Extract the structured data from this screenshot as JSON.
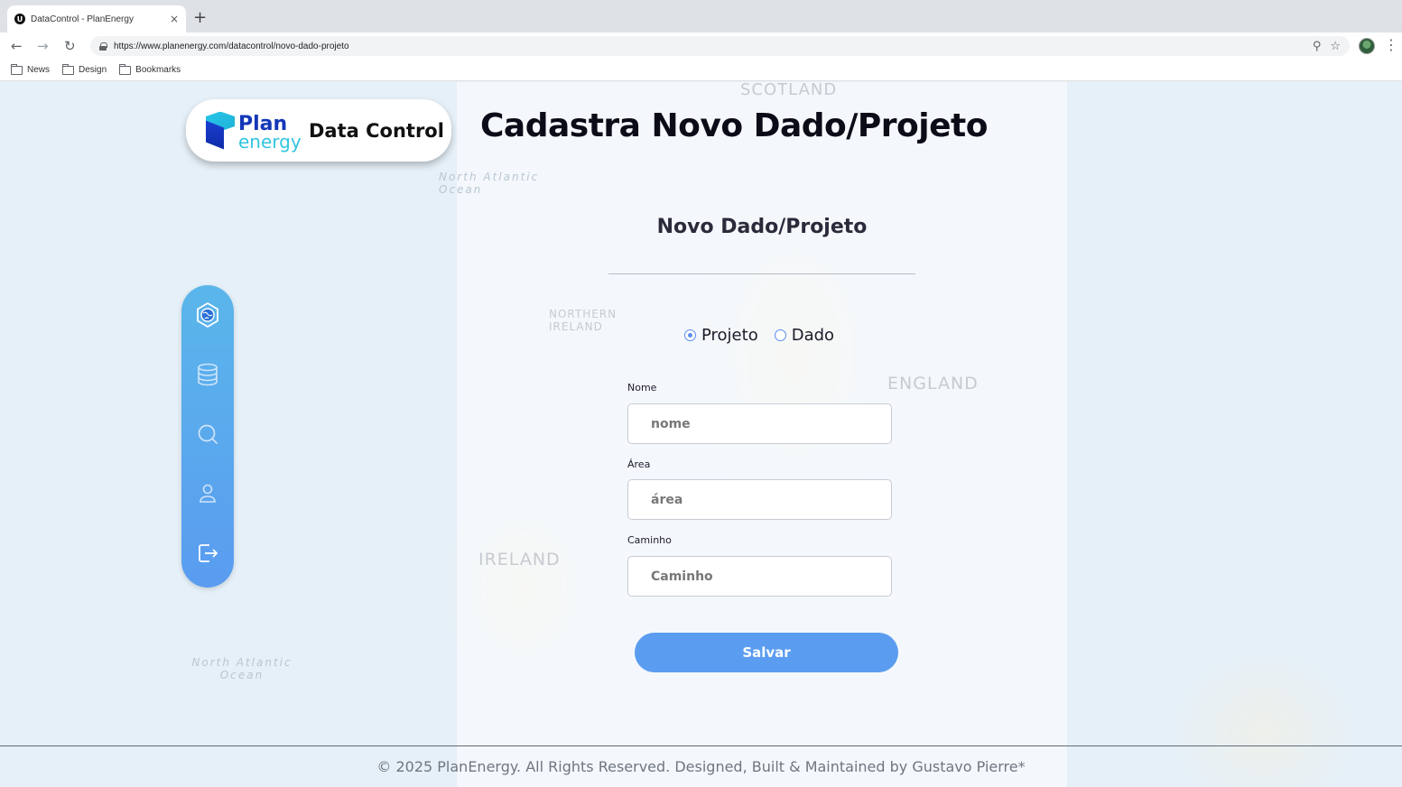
{
  "browser": {
    "tab_title": "DataControl - PlanEnergy",
    "tab_favicon_letter": "U",
    "tab_close": "×",
    "new_tab": "+",
    "url": "https://www.planenergy.com/datacontrol/novo-dado-projeto",
    "bookmarks": [
      "News",
      "Design",
      "Bookmarks"
    ]
  },
  "logo": {
    "plan": "Plan",
    "energy": "energy",
    "product": "Data Control"
  },
  "page_title": "Cadastra Novo Dado/Projeto",
  "map_labels": {
    "scotland": "SCOTLAND",
    "north_atlantic_1": "North Atlantic Ocean",
    "north_atlantic_2": "North Atlantic Ocean",
    "northern_ireland": "NORTHERN IRELAND",
    "ireland": "IRELAND",
    "england": "ENGLAND"
  },
  "sidebar": {
    "items": [
      {
        "icon": "globe-hexagon-icon"
      },
      {
        "icon": "database-icon"
      },
      {
        "icon": "search-icon"
      },
      {
        "icon": "user-icon"
      },
      {
        "icon": "logout-icon"
      }
    ]
  },
  "form": {
    "title": "Novo Dado/Projeto",
    "type_options": [
      {
        "label": "Projeto",
        "selected": true
      },
      {
        "label": "Dado",
        "selected": false
      }
    ],
    "fields": [
      {
        "label": "Nome",
        "placeholder": "nome",
        "value": ""
      },
      {
        "label": "Área",
        "placeholder": "área",
        "value": ""
      },
      {
        "label": "Caminho",
        "placeholder": "Caminho",
        "value": ""
      }
    ],
    "submit_label": "Salvar"
  },
  "footer": "© 2025 PlanEnergy. All Rights Reserved. Designed, Built & Maintained by Gustavo Pierre*",
  "colors": {
    "accent": "#5a9cf0",
    "sidebar_top": "#5ab6ea",
    "title": "#0c0c18",
    "logo_blue": "#1437b8",
    "logo_cyan": "#33c4e0"
  }
}
